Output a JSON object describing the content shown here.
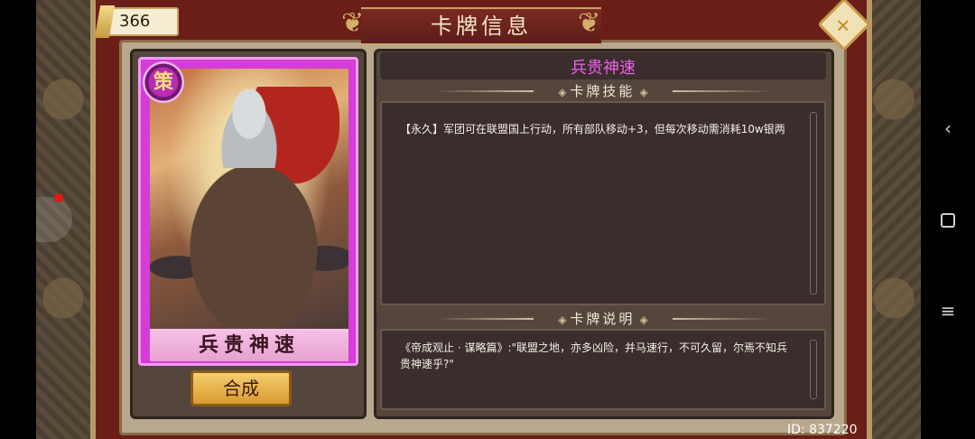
{
  "counter": {
    "value": "366"
  },
  "header": {
    "title": "卡牌信息"
  },
  "card": {
    "name": "兵贵神速",
    "badge": "策"
  },
  "actions": {
    "merge_label": "合成"
  },
  "skill": {
    "title": "兵贵神速",
    "section_label": "卡牌技能",
    "text": "【永久】军团可在联盟国上行动，所有部队移动+3，但每次移动需消耗10w银两"
  },
  "description": {
    "section_label": "卡牌说明",
    "text": "《帝成观止 · 谋略篇》:\"联盟之地，亦多凶险，并马速行，不可久留，尔焉不知兵贵神速乎?\""
  },
  "footer": {
    "id": "ID: 837220"
  },
  "colors": {
    "card_accent": "#d63cd6",
    "skill_title": "#ee5fe5",
    "frame": "#6b1e18",
    "button": "#f6cf6e"
  },
  "icons": {
    "close": "close-icon",
    "back": "back-icon",
    "home": "home-icon",
    "recent": "recent-apps-icon"
  }
}
